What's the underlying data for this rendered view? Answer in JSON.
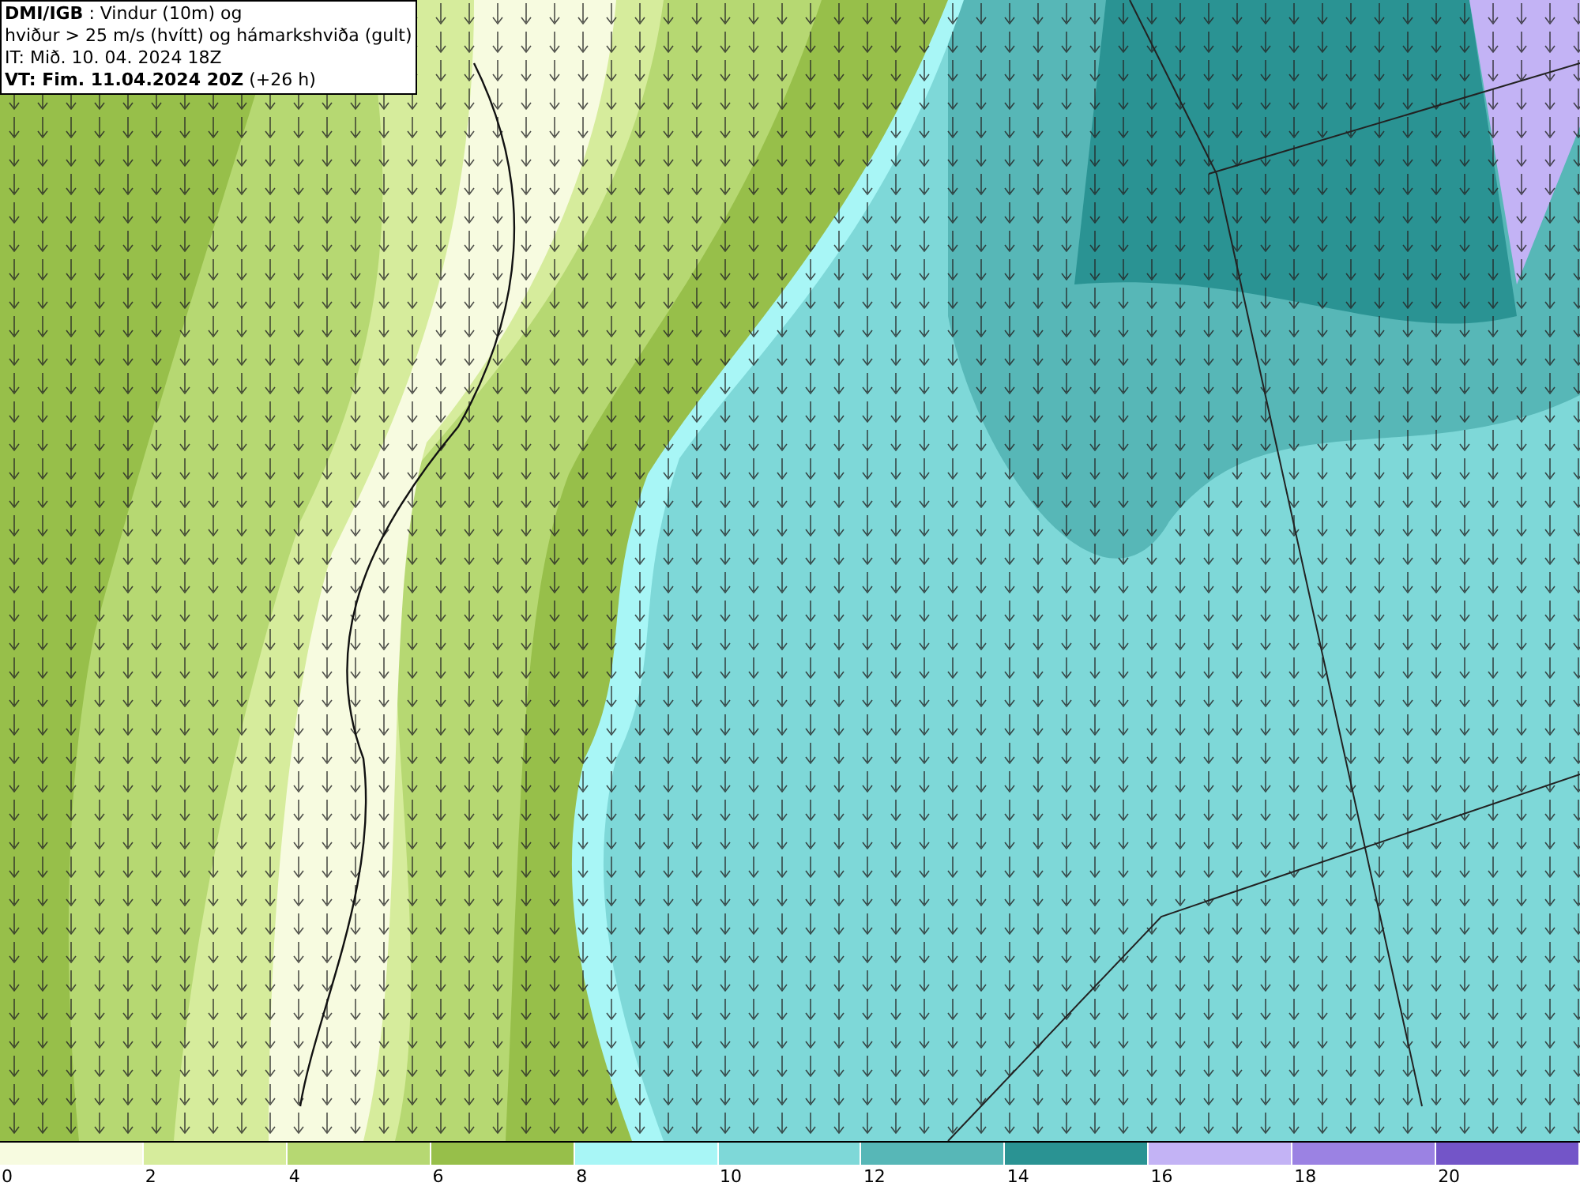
{
  "header": {
    "lines": [
      "**DMI/IGB** : Vindur (10m) og",
      "hviður > 25 m/s (hvítt) og hámarkshviða (gult)",
      "IT: Mið. 10. 04. 2024 18Z",
      "**VT: Fim. 11.04.2024 20Z** (+26 h)"
    ]
  },
  "legend": [
    {
      "label": "0",
      "color": "#f7fbe0"
    },
    {
      "label": "2",
      "color": "#d6ec9c"
    },
    {
      "label": "4",
      "color": "#b6d872"
    },
    {
      "label": "6",
      "color": "#97bf4a"
    },
    {
      "label": "8",
      "color": "#a8f6f6"
    },
    {
      "label": "10",
      "color": "#7ed8d8"
    },
    {
      "label": "12",
      "color": "#57b7b7"
    },
    {
      "label": "14",
      "color": "#2a9393"
    },
    {
      "label": "16",
      "color": "#c3b3f5"
    },
    {
      "label": "18",
      "color": "#9b82e3"
    },
    {
      "label": "20",
      "color": "#7355c8"
    }
  ]
}
